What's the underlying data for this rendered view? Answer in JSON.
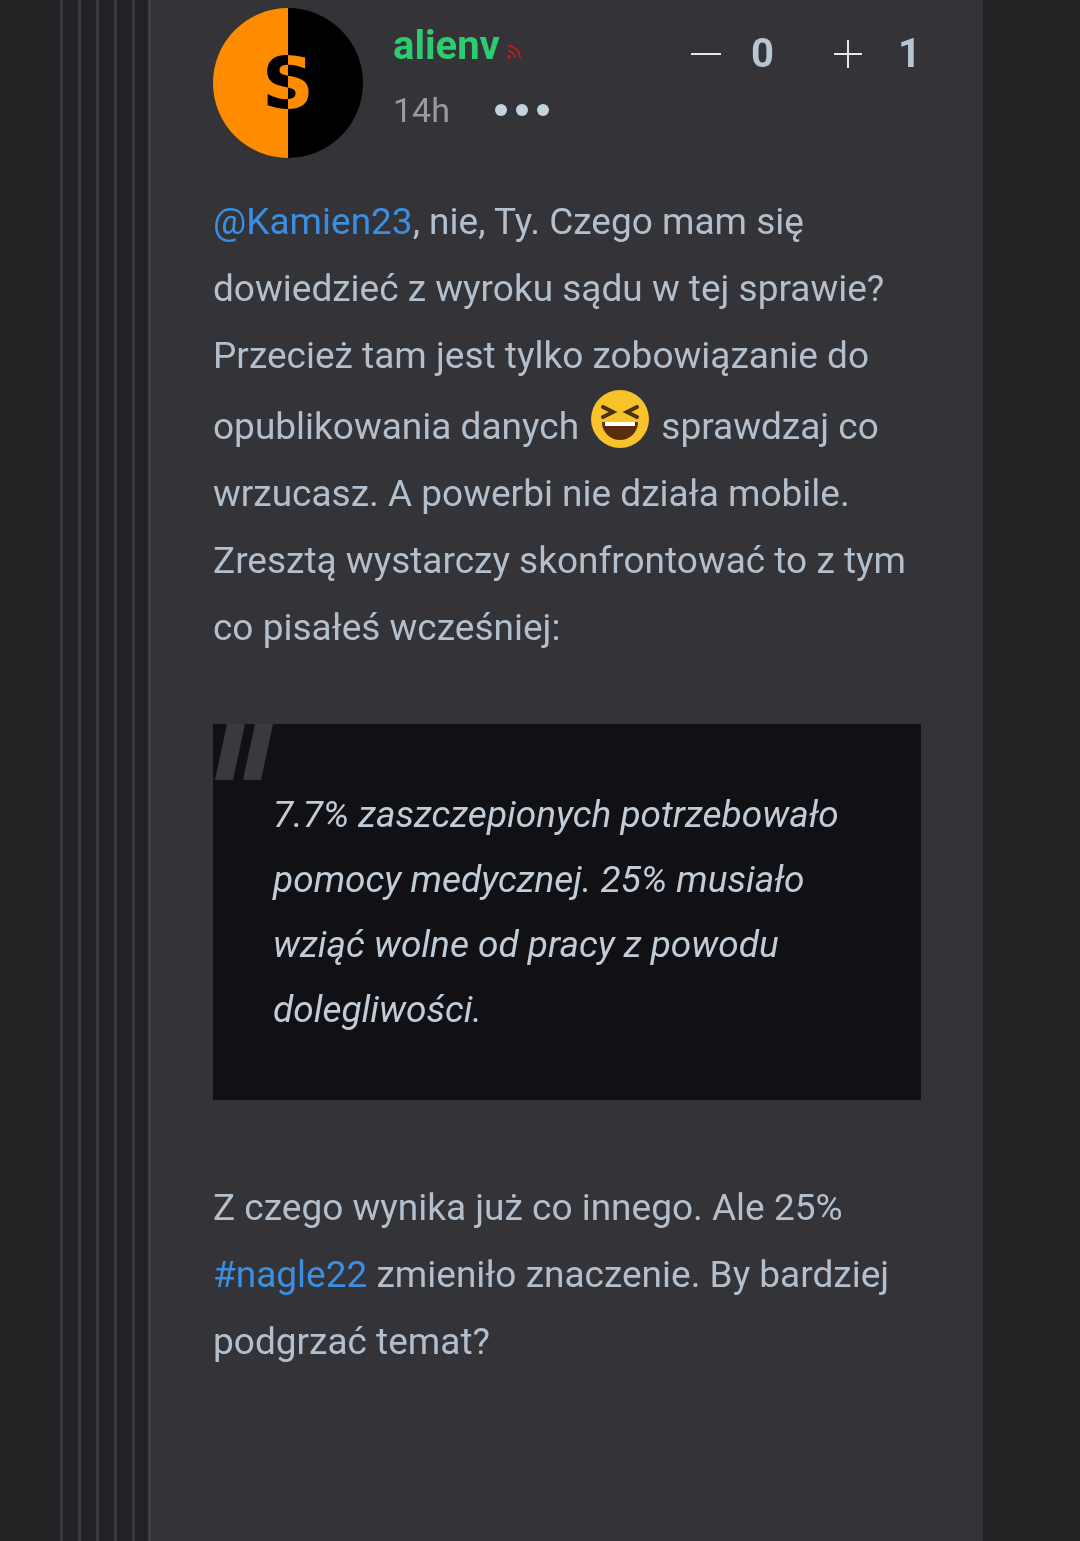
{
  "post": {
    "avatar": {
      "letter": "S"
    },
    "author": "alienv",
    "time": "14h",
    "votes": {
      "minus": "0",
      "plus": "1"
    },
    "body": [
      {
        "kind": "paragraph",
        "parts": [
          {
            "kind": "mention",
            "text": "@Kamien23"
          },
          {
            "kind": "text",
            "text": ", nie, Ty. Czego mam się dowiedzieć z wyroku sądu w tej sprawie? Przecież tam jest tylko zobowiązanie do opublikowania danych "
          },
          {
            "kind": "emoji"
          },
          {
            "kind": "text",
            "text": " sprawdzaj co wrzucasz. A powerbi nie działa mobile. Zresztą wystarczy skonfrontować to z tym co pisałeś wcześniej:"
          }
        ]
      },
      {
        "kind": "quote",
        "text": "7.7% zaszczepionych potrzebowało pomocy medycznej. 25% musiało wziąć wolne od pracy z powodu dolegliwości."
      },
      {
        "kind": "paragraph",
        "parts": [
          {
            "kind": "text",
            "text": "Z czego wynika już co innego. Ale 25% "
          },
          {
            "kind": "hashtag",
            "text": "#nagle22"
          },
          {
            "kind": "text",
            "text": " zmieniło znaczenie. By bardziej podgrzać temat?"
          }
        ]
      }
    ]
  }
}
